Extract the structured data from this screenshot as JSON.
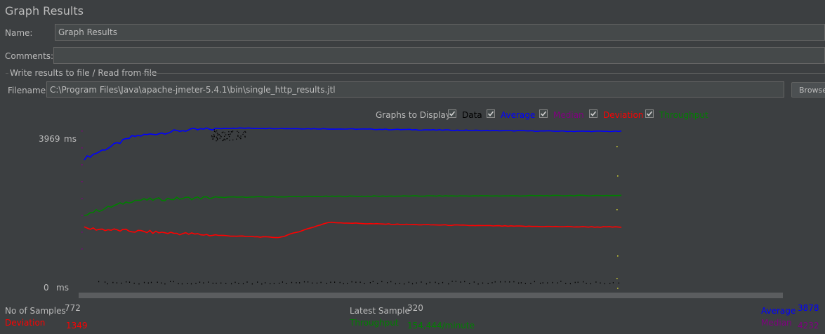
{
  "panel": {
    "title": "Graph Results"
  },
  "name_field": {
    "label": "Name:",
    "value": "Graph Results"
  },
  "comments_field": {
    "label": "Comments:",
    "value": ""
  },
  "file_section": {
    "legend": "Write results to file / Read from file",
    "filename_label": "Filename",
    "filename_value": "C:\\Program Files\\Java\\apache-jmeter-5.4.1\\bin\\single_http_results.jtl",
    "browse_label": "Browse..."
  },
  "graphs_to_display": {
    "label": "Graphs to Display",
    "options": [
      {
        "label": "Data",
        "checked": true,
        "color": "#000000"
      },
      {
        "label": "Average",
        "checked": true,
        "color": "#0000ff"
      },
      {
        "label": "Median",
        "checked": true,
        "color": "#800080"
      },
      {
        "label": "Deviation",
        "checked": true,
        "color": "#ff0000"
      },
      {
        "label": "Throughput",
        "checked": true,
        "color": "#008000"
      }
    ]
  },
  "axis": {
    "max_label": "3969",
    "max_unit": "ms",
    "min_label": "0",
    "min_unit": "ms"
  },
  "stats": {
    "samples_label": "No of Samples",
    "samples_value": "772",
    "deviation_label": "Deviation",
    "deviation_value": "1349",
    "latest_label": "Latest Sample",
    "latest_value": "320",
    "throughput_label": "Throughput",
    "throughput_value": "154,444/minute",
    "average_label": "Average",
    "average_value": "3878",
    "median_label": "Median",
    "median_value": "4232"
  },
  "chart_data": {
    "type": "line",
    "samples": 772,
    "ylim": [
      0,
      3969
    ],
    "series": [
      {
        "name": "Average",
        "color": "#0000ff",
        "approx_values": [
          3200,
          3750,
          3900,
          3960,
          3950,
          3940,
          3930,
          3915,
          3900,
          3890,
          3880,
          3878
        ]
      },
      {
        "name": "Throughput",
        "color": "#008000",
        "approx_values": [
          1800,
          2150,
          2200,
          2230,
          2240,
          2250,
          2255,
          2260,
          2262,
          2265,
          2270,
          2272
        ]
      },
      {
        "name": "Deviation",
        "color": "#ff0000",
        "approx_values": [
          1450,
          1380,
          1320,
          1260,
          1220,
          1600,
          1560,
          1540,
          1520,
          1500,
          1490,
          1480
        ]
      }
    ]
  }
}
